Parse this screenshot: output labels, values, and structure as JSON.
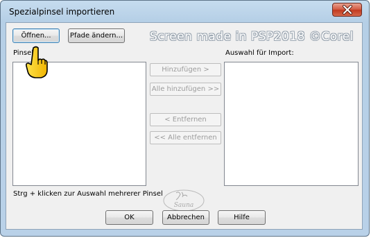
{
  "window": {
    "title": "Spezialpinsel importieren"
  },
  "toolbar": {
    "open_label": "Öffnen...",
    "change_paths_label": "Pfade ändern..."
  },
  "watermark": {
    "text": "Screen made in PSP2018 ©Corel"
  },
  "left_panel": {
    "label": "Pinsel:",
    "hint": "Strg + klicken zur Auswahl mehrerer Pinsel"
  },
  "right_panel": {
    "label": "Auswahl für Import:"
  },
  "middle_buttons": {
    "add_label": "Hinzufügen >",
    "add_all_label": "Alle hinzufügen >>",
    "remove_label": "< Entfernen",
    "remove_all_label": "<< Alle entfernen"
  },
  "footer": {
    "ok_label": "OK",
    "cancel_label": "Abbrechen",
    "help_label": "Hilfe"
  },
  "signature": {
    "text": "Sauna"
  },
  "colors": {
    "close_button": "#c13a1f",
    "title_bar": "#b9d1e8",
    "focus_border": "#3c7fb1"
  },
  "icons": {
    "close": "close-icon",
    "pointer": "pointing-hand-icon",
    "signature": "signature-logo"
  }
}
